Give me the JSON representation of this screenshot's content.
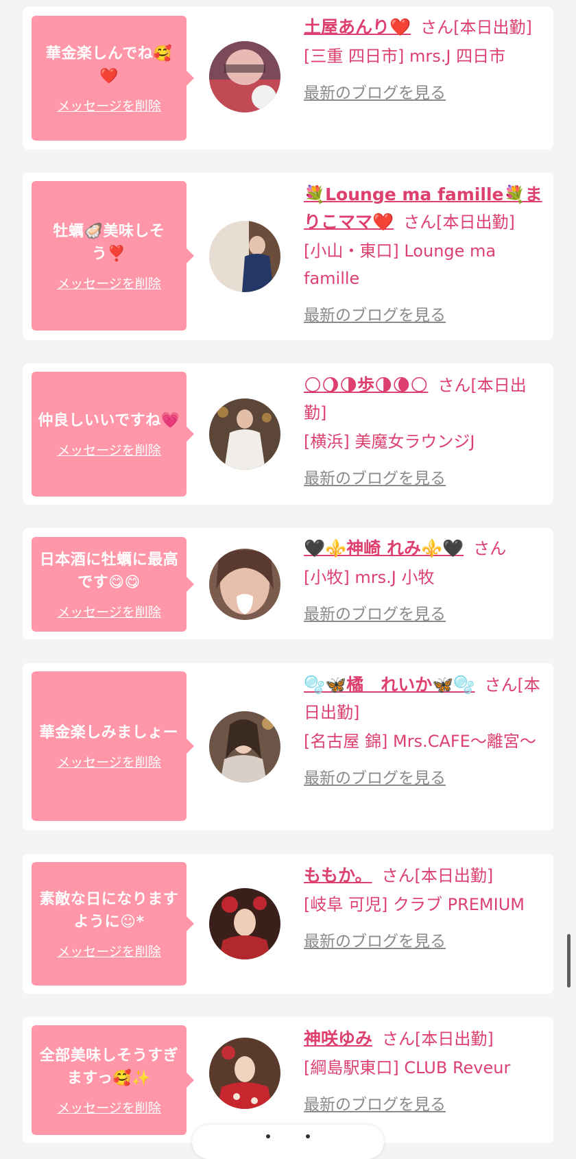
{
  "delete_label": "メッセージを削除",
  "blog_label": "最新のブログを見る",
  "honorific": "さん",
  "messages": [
    {
      "text": "華金楽しんでね🥰❤️",
      "name": "土屋あんり❤️",
      "status": "[本日出勤]",
      "shop": "[三重 四日市] mrs.J 四日市"
    },
    {
      "text": "牡蠣🦪美味しそう❣️",
      "name": "💐Lounge ma famille💐まりこママ❤️",
      "status": "[本日出勤]",
      "shop": "[小山・東口] Lounge ma famille"
    },
    {
      "text": "仲良しいいですね💗",
      "name": "🌕🌖🌗歩🌗🌘🌕",
      "status": "[本日出勤]",
      "shop": "[横浜] 美魔女ラウンジJ"
    },
    {
      "text": "日本酒に牡蠣に最高です😋😋",
      "name": "🖤⚜️神崎 れみ⚜️🖤",
      "status": "",
      "shop": "[小牧] mrs.J 小牧"
    },
    {
      "text": "華金楽しみましょー",
      "name": "🫧🦋橘　れいか🦋🫧",
      "status": "[本日出勤]",
      "shop": "[名古屋 錦] Mrs.CAFE〜離宮〜"
    },
    {
      "text": "素敵な日になりますように☺︎*",
      "name": "ももか。",
      "status": "[本日出勤]",
      "shop": "[岐阜 可児] クラブ PREMIUM"
    },
    {
      "text": "全部美味しそうすぎますっ🥰✨",
      "name": "神咲ゆみ",
      "status": "[本日出勤]",
      "shop": "[綱島駅東口] CLUB Reveur"
    }
  ]
}
